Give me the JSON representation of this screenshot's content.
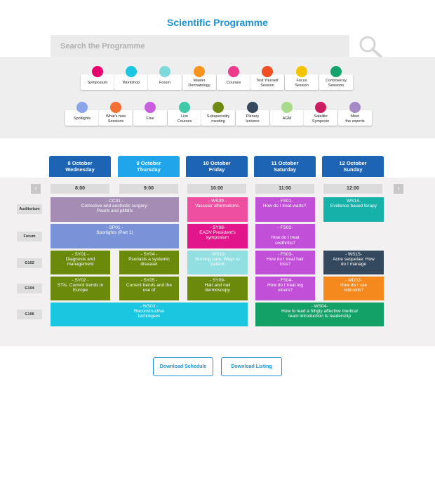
{
  "page": {
    "title": "Scientific Programme"
  },
  "search": {
    "placeholder": "Search the Programme",
    "icon": "search-icon"
  },
  "categories": [
    {
      "label": "Symposium",
      "color": "#e6006e"
    },
    {
      "label": "Workshop",
      "color": "#1ac6e0"
    },
    {
      "label": "Forum",
      "color": "#7fd9dc"
    },
    {
      "label": "Master\nDermatology",
      "color": "#f7941d"
    },
    {
      "label": "Courses",
      "color": "#ee3a8c"
    },
    {
      "label": "Test Yourself\nSession",
      "color": "#f04e23"
    },
    {
      "label": "Focus\nSession",
      "color": "#f5c400"
    },
    {
      "label": "Controversy\nSessions",
      "color": "#15a36e"
    },
    {
      "label": "Spotlights",
      "color": "#8aa6e8"
    },
    {
      "label": "What's new\nSessions",
      "color": "#f36f34"
    },
    {
      "label": "Free",
      "color": "#c95fe0"
    },
    {
      "label": "Live\nCourses",
      "color": "#3fc9a8"
    },
    {
      "label": "Subspeciality\nmeeting",
      "color": "#6f8a12"
    },
    {
      "label": "Plenary\nlectures",
      "color": "#34495e"
    },
    {
      "label": "AGM",
      "color": "#a8dc8c"
    },
    {
      "label": "Satellite\nSymposio",
      "color": "#cc1c60"
    },
    {
      "label": "Meet\nthe experts",
      "color": "#a58ac5"
    }
  ],
  "days": [
    {
      "label": "8 October\nWednesday",
      "color": "#1e64b4"
    },
    {
      "label": "9 October\nThursday",
      "color": "#20a4ea"
    },
    {
      "label": "10 October\nFriday",
      "color": "#1e64b4"
    },
    {
      "label": "11 October\nSaturday",
      "color": "#1e64b4"
    },
    {
      "label": "12 October\nSunday",
      "color": "#1e64b4"
    }
  ],
  "nav": {
    "prev": "‹",
    "next": "›"
  },
  "times": [
    "8:00",
    "9:00",
    "10:00",
    "11:00",
    "12:00"
  ],
  "rooms": [
    "Auditorium",
    "Forum",
    "G102",
    "G104",
    "G106"
  ],
  "sessions": [
    {
      "text": "- CC01 -\nCorrective and aesthetic surgery:\nPearls and pitfalls",
      "color": "#a58cb5"
    },
    {
      "text": "- WS09 -\nVascular alformations.",
      "color": "#ef4fa0"
    },
    {
      "text": "- FS01-\nHow do I treat warts?.",
      "color": "#c24fd8"
    },
    {
      "text": "WS14-\nEvidence based terapy",
      "color": "#16b1a8"
    },
    {
      "text": "- SP01 -\nSporlights (Part 1)",
      "color": "#7a93d8"
    },
    {
      "text": "- SY08-\nEADV President's\nsymposium",
      "color": "#e2168a"
    },
    {
      "text": "- FS02-\n\nHow do I treat\nurethritis?",
      "color": "#c24fd8"
    },
    {
      "text": "- SY01 -\nDiagnosis and\nmanagement",
      "color": "#6b8a0c"
    },
    {
      "text": "- SY04 -\nPsoriasis a systemic\ndiseaset",
      "color": "#6b8a0c"
    },
    {
      "text": "- WS10-\nNursing care: Ways to\npatient",
      "color": "#92dfe2"
    },
    {
      "text": "- FS03-\nHow do I treat hair\nloss?",
      "color": "#c24fd8"
    },
    {
      "text": "- WS15-\nAcne sequelae: How\ndo I manage",
      "color": "#35495e"
    },
    {
      "text": "- SY02 -\nSTIs. Current trends in\nEurope",
      "color": "#6b8a0c"
    },
    {
      "text": "- SY05 -\nCurrent trends and the\nuse of",
      "color": "#6b8a0c"
    },
    {
      "text": "- SY09-\nHair and nail\ndermoscopy",
      "color": "#6b8a0c"
    },
    {
      "text": "- FS04-\nHow do I treat leg\nulcers?",
      "color": "#c24fd8"
    },
    {
      "text": "- MD02-\nHow do I use\nretinoids?",
      "color": "#f5891e"
    },
    {
      "text": "- WS03 -\nReconstructive\ntechniques",
      "color": "#1ac6e0"
    },
    {
      "text": "- WS04-\nHow to lead a hihgly affective medical\nteam introduction to leadership",
      "color": "#13a167"
    }
  ],
  "actions": {
    "download_schedule": "Download Schedule",
    "download_listing": "Download Listing"
  }
}
